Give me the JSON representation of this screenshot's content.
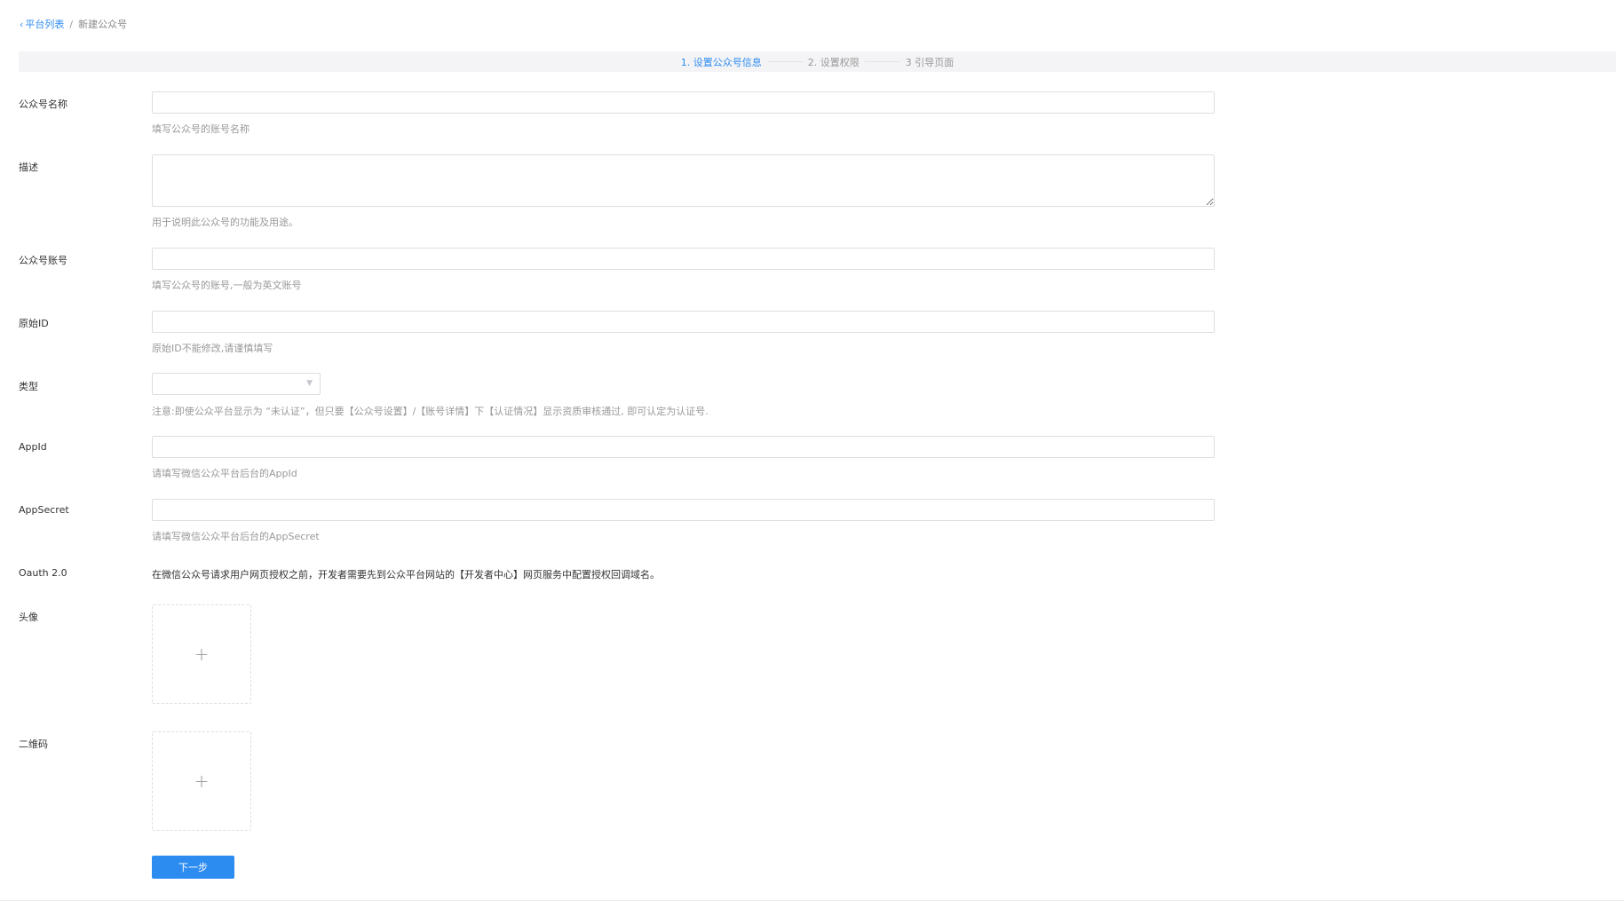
{
  "breadcrumb": {
    "back_icon": "chevron-left-icon",
    "parent": "平台列表",
    "separator": "/",
    "current": "新建公众号"
  },
  "steps": [
    {
      "label": "1. 设置公众号信息",
      "active": true
    },
    {
      "label": "2. 设置权限",
      "active": false
    },
    {
      "label": "3 引导页面",
      "active": false
    }
  ],
  "form": {
    "name": {
      "label": "公众号名称",
      "value": "",
      "hint": "填写公众号的账号名称"
    },
    "description": {
      "label": "描述",
      "value": "",
      "hint": "用于说明此公众号的功能及用途。"
    },
    "account": {
      "label": "公众号账号",
      "value": "",
      "hint": "填写公众号的账号,一般为英文账号"
    },
    "original_id": {
      "label": "原始ID",
      "value": "",
      "hint": "原始ID不能修改,请谨慎填写"
    },
    "type": {
      "label": "类型",
      "value": "",
      "hint": "注意:即使公众平台显示为 “未认证”，但只要【公众号设置】/【账号详情】下【认证情况】显示资质审核通过, 即可认定为认证号."
    },
    "appid": {
      "label": "AppId",
      "value": "",
      "hint": "请填写微信公众平台后台的AppId"
    },
    "appsecret": {
      "label": "AppSecret",
      "value": "",
      "hint": "请填写微信公众平台后台的AppSecret"
    },
    "oauth": {
      "label": "Oauth 2.0",
      "text": "在微信公众号请求用户网页授权之前，开发者需要先到公众平台网站的【开发者中心】网页服务中配置授权回调域名。"
    },
    "avatar": {
      "label": "头像",
      "icon": "plus-icon",
      "symbol": "+"
    },
    "qrcode": {
      "label": "二维码",
      "icon": "plus-icon",
      "symbol": "+"
    }
  },
  "next_button": "下一步",
  "colors": {
    "accent": "#2d8cf0",
    "step_bar": "#f4f4f6",
    "border": "#dcdee2"
  }
}
